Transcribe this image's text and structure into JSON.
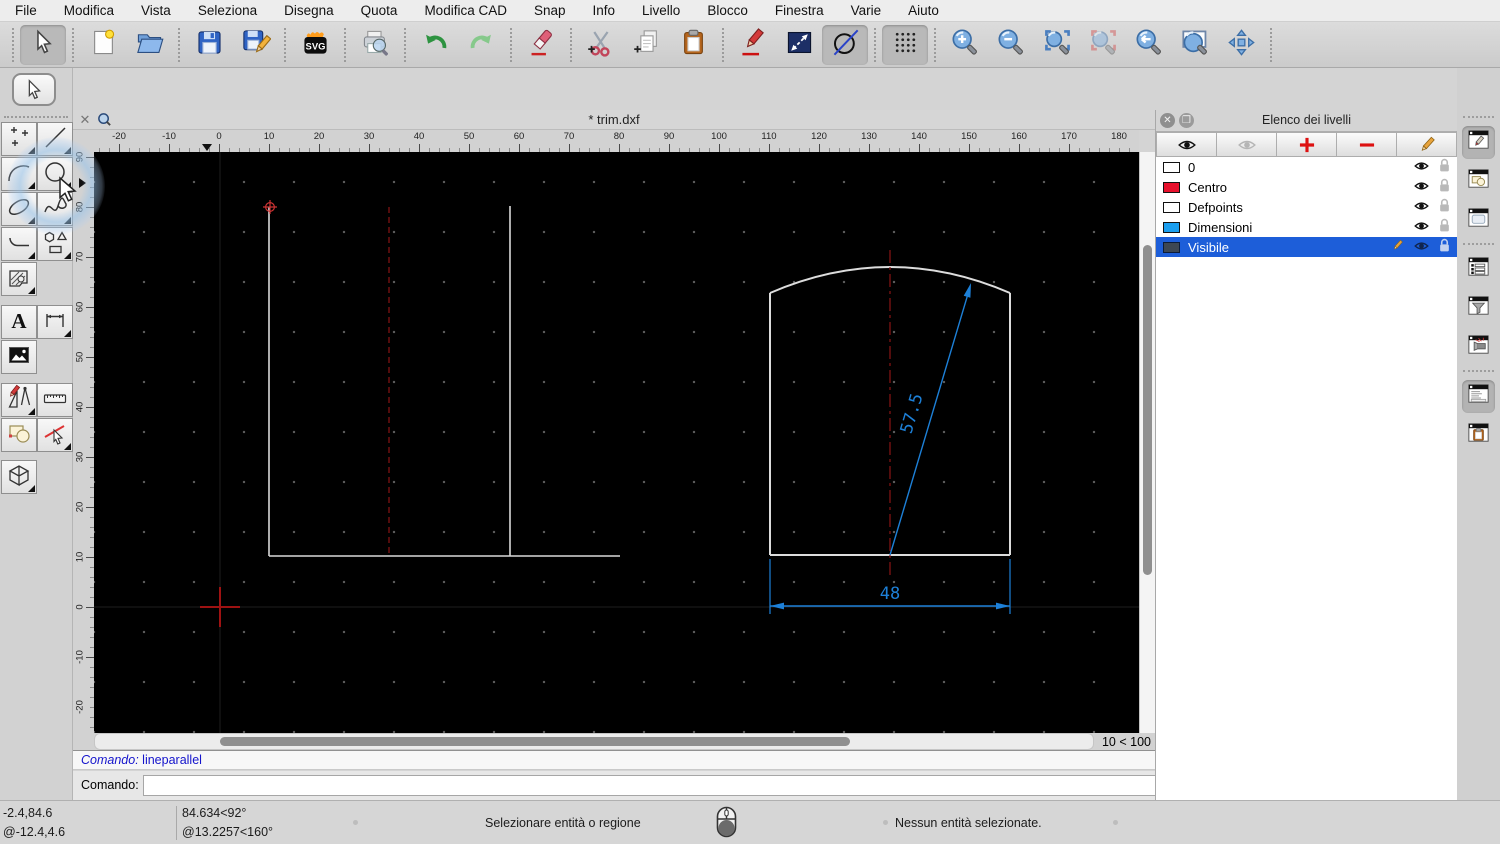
{
  "app": {
    "tab_title": "* trim.dxf",
    "zoom_indicator": "10 < 100",
    "tab_close": "✕"
  },
  "menu": {
    "items": [
      "File",
      "Modifica",
      "Vista",
      "Seleziona",
      "Disegna",
      "Quota",
      "Modifica CAD",
      "Snap",
      "Info",
      "Livello",
      "Blocco",
      "Finestra",
      "Varie",
      "Aiuto"
    ]
  },
  "toolbar": {
    "svg_icon_text": "SVG",
    "groups": [
      [
        "select-tool"
      ],
      [
        "new-file",
        "open-folder"
      ],
      [
        "save",
        "save-as"
      ],
      [
        "svg-export"
      ],
      [
        "print-preview"
      ],
      [
        "undo",
        "redo"
      ],
      [
        "eraser"
      ],
      [
        "cut",
        "copy",
        "paste"
      ],
      [
        "draw-pencil",
        "distance-arrow",
        "circle-line"
      ],
      [
        "grid-toggle"
      ],
      [
        "zoom-in",
        "zoom-out",
        "zoom-auto",
        "zoom-selection",
        "zoom-previous",
        "zoom-window",
        "pan"
      ]
    ],
    "pressed": [
      "select-tool",
      "circle-line",
      "grid-toggle"
    ],
    "disabled": [
      "zoom-selection"
    ]
  },
  "palette": {
    "tools": [
      {
        "name": "points",
        "corner": true
      },
      {
        "name": "line",
        "corner": true
      },
      {
        "name": "arc",
        "corner": true
      },
      {
        "name": "circle",
        "corner": true
      },
      {
        "name": "ellipse",
        "corner": true
      },
      {
        "name": "spline",
        "corner": true
      },
      {
        "name": "polyline",
        "corner": true
      },
      {
        "name": "polygon",
        "corner": true
      },
      {
        "name": "hatch",
        "corner": true
      },
      {
        "name": "text",
        "corner": false
      },
      {
        "name": "dimension",
        "corner": true
      },
      {
        "name": "image",
        "corner": false
      },
      {
        "name": "modify",
        "corner": true
      },
      {
        "name": "measure",
        "corner": false
      },
      {
        "name": "blocks",
        "corner": false
      },
      {
        "name": "select-entity",
        "corner": true
      },
      {
        "name": "solid3d",
        "corner": true
      }
    ]
  },
  "rulers": {
    "horizontal": [
      "-20",
      "-10",
      "0",
      "10",
      "20",
      "30",
      "40",
      "50",
      "60",
      "70",
      "80",
      "90",
      "100",
      "110",
      "120",
      "130",
      "140",
      "150",
      "160",
      "170",
      "180"
    ],
    "vertical": [
      "90",
      "80",
      "70",
      "60",
      "50",
      "40",
      "30",
      "20",
      "10",
      "0",
      "-10",
      "-20"
    ]
  },
  "canvas": {
    "dim_radius": "57.5",
    "dim_width": "48"
  },
  "layers_panel": {
    "title": "Elenco dei livelli",
    "toolbar": [
      {
        "name": "show-all-layers",
        "icon": "eye"
      },
      {
        "name": "hide-all-layers",
        "icon": "eye-faded"
      },
      {
        "name": "add-layer",
        "icon": "plus"
      },
      {
        "name": "remove-layer",
        "icon": "minus"
      },
      {
        "name": "edit-layer",
        "icon": "pencil"
      }
    ],
    "layers": [
      {
        "name": "0",
        "color": "#ffffff",
        "selected": false
      },
      {
        "name": "Centro",
        "color": "#e8112d",
        "selected": false
      },
      {
        "name": "Defpoints",
        "color": "#ffffff",
        "selected": false
      },
      {
        "name": "Dimensioni",
        "color": "#1b9ff0",
        "selected": false
      },
      {
        "name": "Visibile",
        "color": "#3d4753",
        "selected": true
      }
    ]
  },
  "right_dock": {
    "items": [
      {
        "name": "property-editor-window",
        "pressed": true
      },
      {
        "name": "blocks-window",
        "pressed": false
      },
      {
        "name": "library-window",
        "pressed": false
      },
      {
        "name": "layer-list-window",
        "pressed": false
      },
      {
        "name": "selection-filter-window",
        "pressed": false
      },
      {
        "name": "inspector-window",
        "pressed": false
      },
      {
        "name": "command-line-window",
        "pressed": true
      },
      {
        "name": "clipboard-window",
        "pressed": false
      }
    ]
  },
  "command": {
    "history_label": "Comando:",
    "history_value": "lineparallel",
    "prompt_label": "Comando:",
    "input_value": "",
    "input_placeholder": ""
  },
  "statusbar": {
    "abs_coord": "-2.4,84.6",
    "rel_coord": "@-12.4,4.6",
    "abs_polar": "84.634<92°",
    "rel_polar": "@13.2257<160°",
    "hint": "Selezionare entità o regione",
    "selection_status": "Nessun entità selezionate."
  }
}
